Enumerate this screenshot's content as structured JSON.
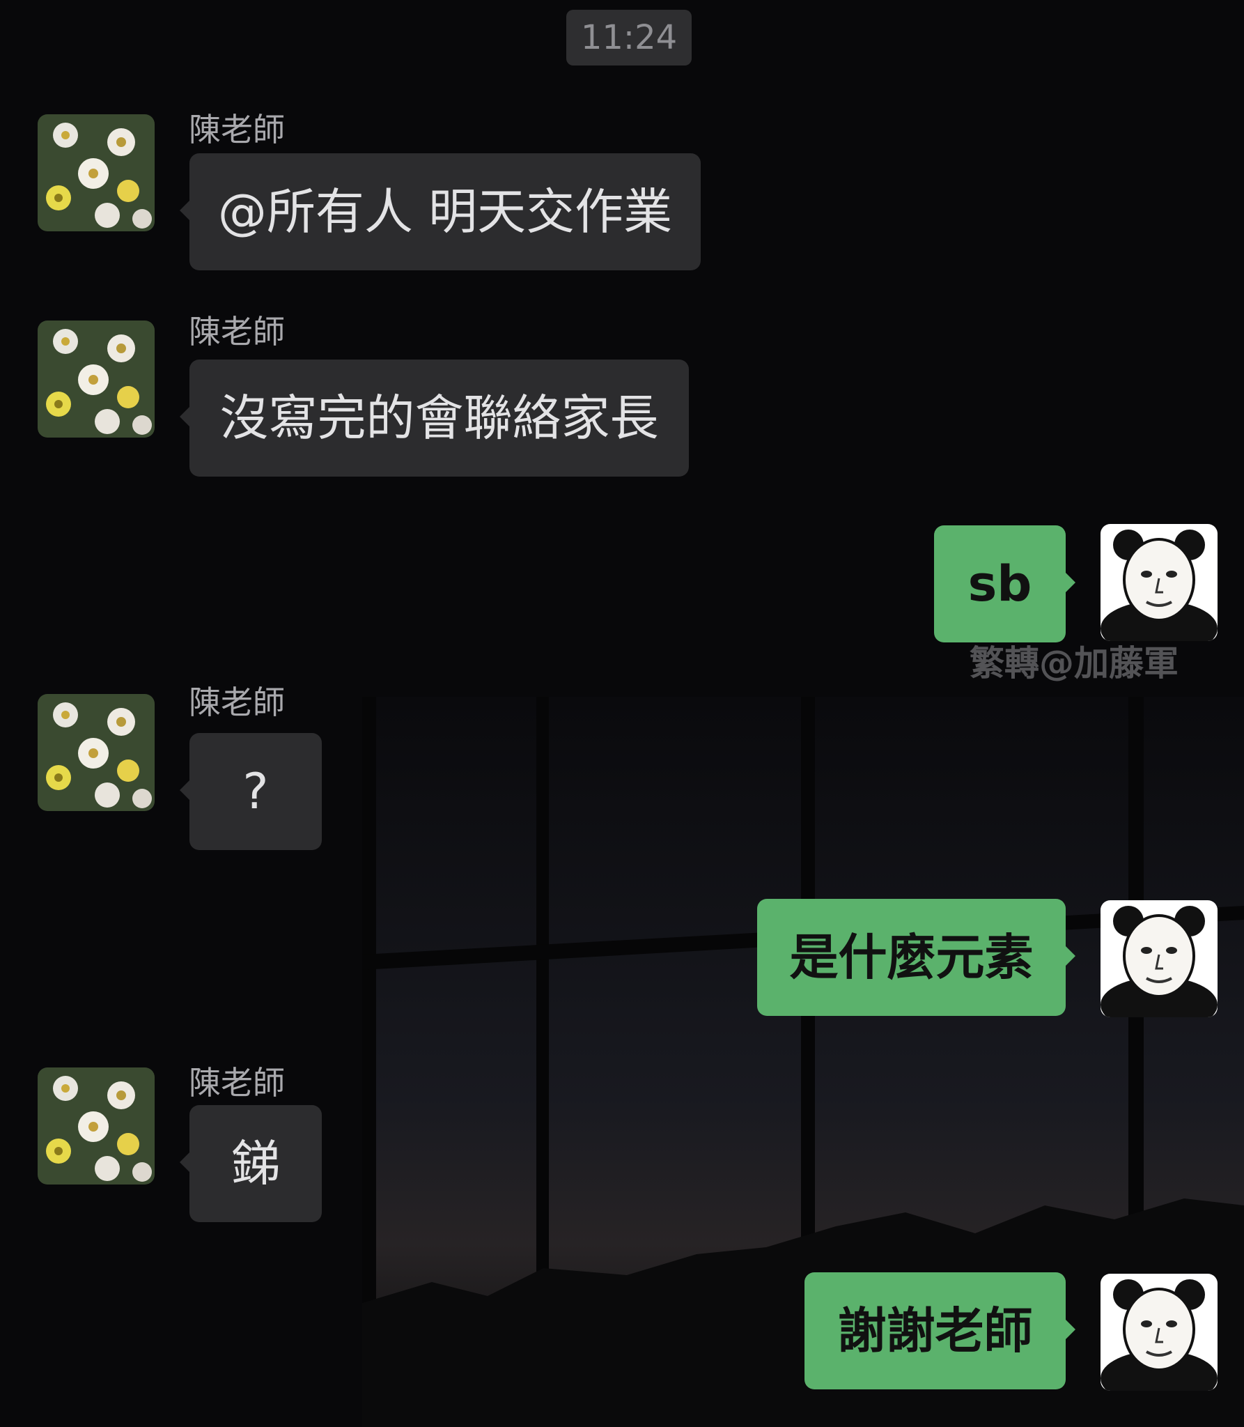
{
  "chat": {
    "timestamp": "11:24",
    "watermark": "繁轉@加藤軍",
    "messages": [
      {
        "side": "left",
        "sender": "陳老師",
        "text": "@所有人 明天交作業",
        "avatar_icon": "flower-avatar-icon"
      },
      {
        "side": "left",
        "sender": "陳老師",
        "text": "沒寫完的會聯絡家長",
        "avatar_icon": "flower-avatar-icon"
      },
      {
        "side": "right",
        "text": "sb",
        "avatar_icon": "panda-meme-avatar-icon"
      },
      {
        "side": "left",
        "sender": "陳老師",
        "text": "?",
        "avatar_icon": "flower-avatar-icon"
      },
      {
        "side": "right",
        "text": "是什麼元素",
        "avatar_icon": "panda-meme-avatar-icon"
      },
      {
        "side": "left",
        "sender": "陳老師",
        "text": "銻",
        "avatar_icon": "flower-avatar-icon"
      },
      {
        "side": "right",
        "text": "謝謝老師",
        "avatar_icon": "panda-meme-avatar-icon"
      }
    ]
  },
  "colors": {
    "background": "#0b0b0d",
    "left_bubble": "#2c2c2e",
    "right_bubble": "#5bb26c",
    "timestamp_pill": "#2e2e30"
  }
}
